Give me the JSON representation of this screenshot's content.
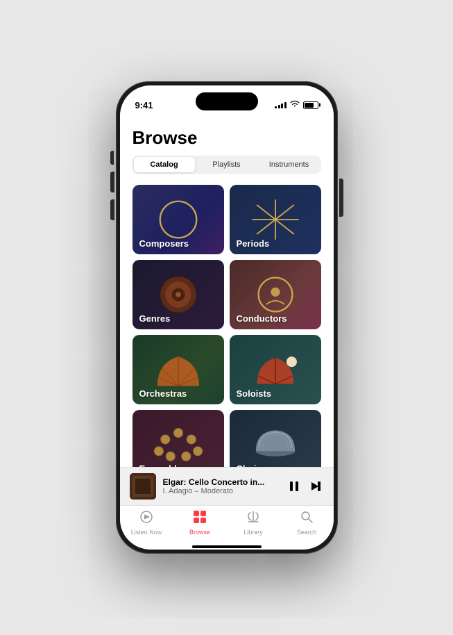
{
  "status": {
    "time": "9:41"
  },
  "header": {
    "title": "Browse"
  },
  "segments": {
    "tabs": [
      "Catalog",
      "Playlists",
      "Instruments"
    ],
    "active": "Catalog"
  },
  "grid": {
    "items": [
      {
        "id": "composers",
        "label": "Composers",
        "bg": "composers"
      },
      {
        "id": "periods",
        "label": "Periods",
        "bg": "periods"
      },
      {
        "id": "genres",
        "label": "Genres",
        "bg": "genres"
      },
      {
        "id": "conductors",
        "label": "Conductors",
        "bg": "conductors"
      },
      {
        "id": "orchestras",
        "label": "Orchestras",
        "bg": "orchestras"
      },
      {
        "id": "soloists",
        "label": "Soloists",
        "bg": "soloists"
      },
      {
        "id": "ensembles",
        "label": "Ensembles",
        "bg": "ensembles"
      },
      {
        "id": "choirs",
        "label": "Choirs",
        "bg": "choirs"
      }
    ]
  },
  "mini_player": {
    "title": "Elgar: Cello Concerto in...",
    "subtitle": "I. Adagio – Moderato"
  },
  "tab_bar": {
    "items": [
      {
        "id": "listen-now",
        "label": "Listen Now",
        "icon": "▶"
      },
      {
        "id": "browse",
        "label": "Browse",
        "icon": "⊞",
        "active": true
      },
      {
        "id": "library",
        "label": "Library",
        "icon": "♩"
      },
      {
        "id": "search",
        "label": "Search",
        "icon": "⌕"
      }
    ]
  }
}
